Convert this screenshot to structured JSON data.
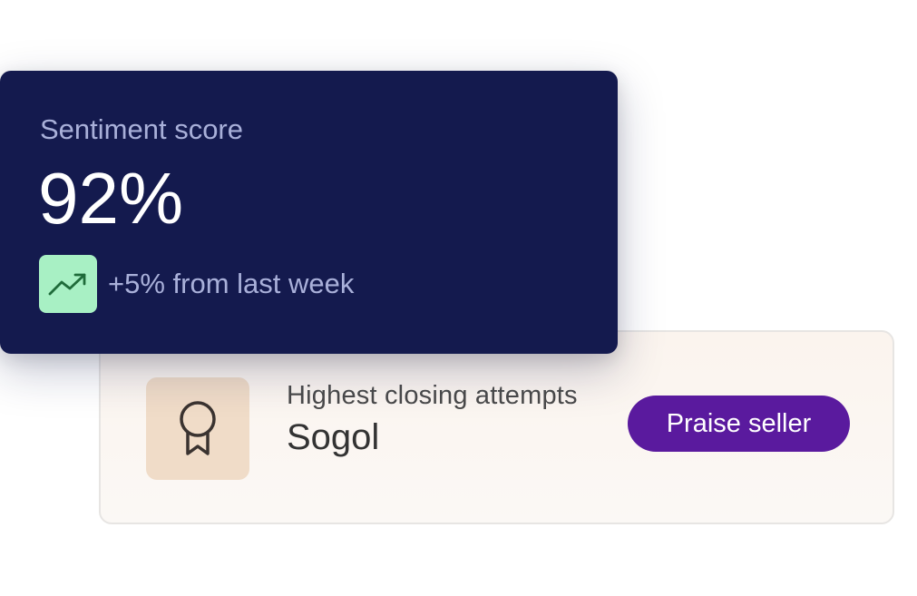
{
  "sentiment": {
    "label": "Sentiment score",
    "value": "92%",
    "trend_text": "+5% from last week",
    "trend_icon": "trending-up-icon"
  },
  "seller": {
    "label": "Highest closing attempts",
    "name": "Sogol",
    "award_icon": "award-ribbon-icon",
    "button_label": "Praise seller"
  },
  "colors": {
    "sentiment_card_bg": "#141a4e",
    "trend_tile_bg": "#a8f0c4",
    "seller_card_bg": "#fbf6f1",
    "award_tile_bg": "#f0dcc8",
    "button_bg": "#5a1a9e"
  }
}
